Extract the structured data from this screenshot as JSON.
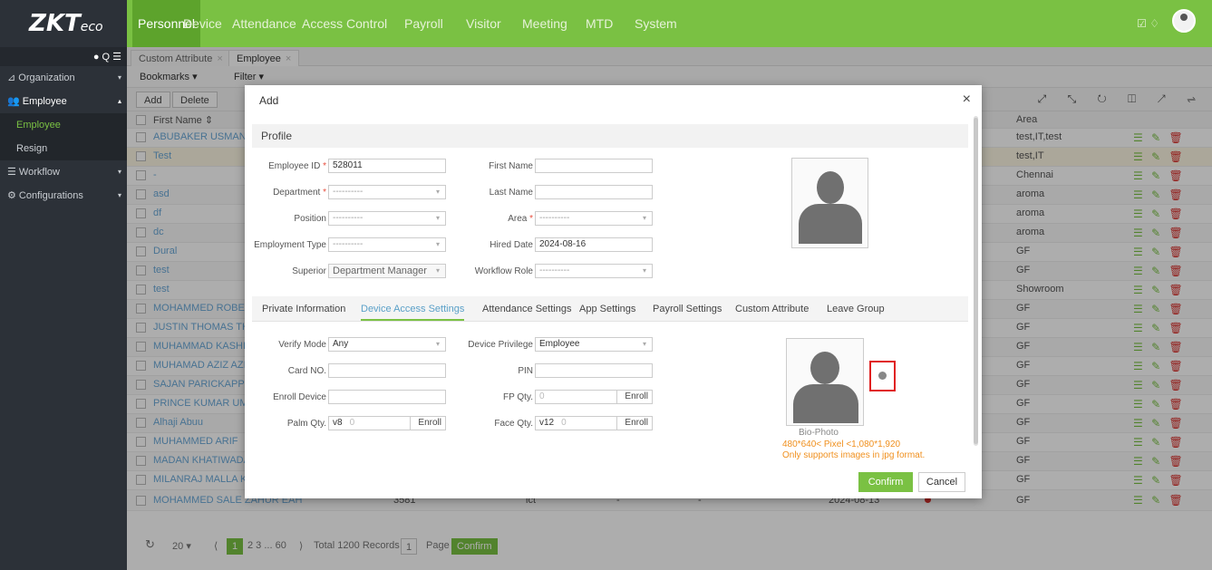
{
  "brand": {
    "logo_main": "ZKT",
    "logo_sub": "eco"
  },
  "nav": [
    "Personnel",
    "Device",
    "Attendance",
    "Access Control",
    "Payroll",
    "Visitor",
    "Meeting",
    "MTD",
    "System"
  ],
  "top_icons": "☑ ♢",
  "sidebar": {
    "tools": "● Q ☰",
    "items": [
      {
        "label": "Organization",
        "type": "item"
      },
      {
        "label": "Employee",
        "type": "item-open"
      },
      {
        "label": "Employee",
        "type": "sub-active"
      },
      {
        "label": "Resign",
        "type": "sub"
      },
      {
        "label": "Workflow",
        "type": "item"
      },
      {
        "label": "Configurations",
        "type": "item"
      }
    ]
  },
  "tabs": [
    {
      "label": "Custom Attribute",
      "close": "×"
    },
    {
      "label": "Employee",
      "close": "×"
    }
  ],
  "toolbar": {
    "bookmarks": "Bookmarks ▾",
    "filter": "Filter ▾"
  },
  "actions": {
    "add": "Add",
    "delete": "Delete"
  },
  "right_icons": "⤢ ⤡ ↻ ◫ ↗ ⇌",
  "table": {
    "header": {
      "name": "First Name ⇕",
      "area": "Area"
    },
    "rows": [
      {
        "name": "ABUBAKER USMAN",
        "area": "test,IT,test"
      },
      {
        "name": "Test",
        "area": "test,IT"
      },
      {
        "name": "-",
        "area": "Chennai"
      },
      {
        "name": "asd",
        "area": "aroma"
      },
      {
        "name": "df",
        "area": "aroma"
      },
      {
        "name": "dc",
        "area": "aroma"
      },
      {
        "name": "Dural",
        "area": "GF"
      },
      {
        "name": "test",
        "area": "GF"
      },
      {
        "name": "test",
        "area": "Showroom"
      },
      {
        "name": "MOHAMMED ROBEL",
        "area": "GF"
      },
      {
        "name": "JUSTIN THOMAS THO",
        "area": "GF"
      },
      {
        "name": "MUHAMMAD KASHIF",
        "area": "GF"
      },
      {
        "name": "MUHAMAD AZIZ AZIZ",
        "area": "GF"
      },
      {
        "name": "SAJAN PARICKAPPILL",
        "area": "GF"
      },
      {
        "name": "PRINCE KUMAR UMES",
        "area": "GF"
      },
      {
        "name": "Alhaji Abuu",
        "area": "GF"
      },
      {
        "name": "MUHAMMED ARIF",
        "area": "GF"
      },
      {
        "name": "MADAN KHATIWADA",
        "area": "GF"
      },
      {
        "name": "MILANRAJ MALLA KR",
        "area": "GF"
      }
    ],
    "last_row": {
      "name": "MOHAMMED SALE ZAHUR EAH",
      "id": "3581",
      "dept": "ict",
      "c1": "-",
      "c2": "-",
      "date": "2024-08-13",
      "area": "GF"
    },
    "ops": "☰ ✎",
    "del": "🗑"
  },
  "pager": {
    "refresh": "↻",
    "size": "20",
    "dd": "▾",
    "prev": "⟨",
    "current": "1",
    "pages": "2  3 ... 60",
    "next": "⟩",
    "total": "Total 1200 Records",
    "page_input": "1",
    "page_label": "Page",
    "confirm": "Confirm"
  },
  "modal": {
    "title": "Add",
    "close": "×",
    "profile_section": "Profile",
    "employee_id_label": "Employee ID",
    "employee_id": "528011",
    "first_name_label": "First Name",
    "first_name": "",
    "department_label": "Department",
    "department": "----------",
    "last_name_label": "Last Name",
    "last_name": "",
    "position_label": "Position",
    "position": "----------",
    "area_label": "Area",
    "area": "----------",
    "employment_type_label": "Employment Type",
    "employment_type": "----------",
    "hired_date_label": "Hired Date",
    "hired_date": "2024-08-16",
    "superior_label": "Superior",
    "superior": "Department Manager",
    "workflow_role_label": "Workflow Role",
    "workflow_role": "----------",
    "required_mark": "*",
    "dd": "▾",
    "tabs": [
      "Private Information",
      "Device Access Settings",
      "Attendance Settings",
      "App Settings",
      "Payroll Settings",
      "Custom Attribute",
      "Leave Group"
    ],
    "verify_mode_label": "Verify Mode",
    "verify_mode": "Any",
    "device_privilege_label": "Device Privilege",
    "device_privilege": "Employee",
    "card_no_label": "Card NO.",
    "card_no": "",
    "pin_label": "PIN",
    "pin": "",
    "enroll_device_label": "Enroll Device",
    "enroll_device": "",
    "fp_qty_label": "FP Qty.",
    "fp_qty": "0",
    "palm_qty_label": "Palm Qty.",
    "palm_version": "v8",
    "palm_qty": "0",
    "face_qty_label": "Face Qty.",
    "face_version": "v12",
    "face_qty": "0",
    "enroll_label": "Enroll",
    "bio_photo_label": "Bio-Photo",
    "bio_note_1": "480*640< Pixel <1,080*1,920",
    "bio_note_2": "Only supports images in jpg format.",
    "confirm": "Confirm",
    "cancel": "Cancel"
  },
  "colors": {
    "brand_green": "#7ac143",
    "sidebar_dark": "#2c3138",
    "link_blue": "#6aa8d8",
    "delete_red": "#d9302c",
    "warning_orange": "#f0901e"
  }
}
